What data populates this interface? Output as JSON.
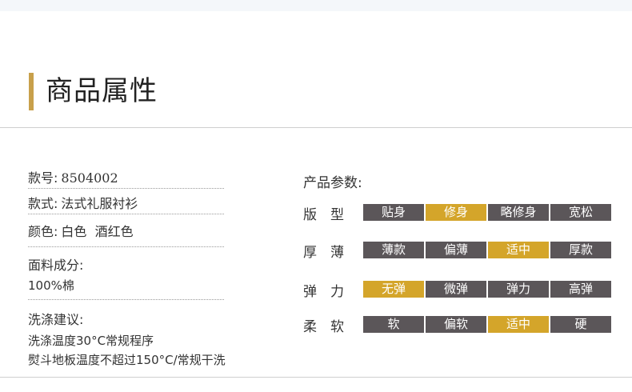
{
  "header": {
    "title": "商品属性"
  },
  "info": {
    "style_no": {
      "label": "款号:",
      "value": "8504002"
    },
    "style": {
      "label": "款式:",
      "value": "法式礼服衬衫"
    },
    "color": {
      "label": "颜色:",
      "value": "白色  酒红色"
    },
    "fabric": {
      "label": "面料成分:",
      "value": "100%棉"
    },
    "washing": {
      "label": "洗涤建议:",
      "line1": "洗涤温度30°C常规程序",
      "line2": "熨斗地板温度不超过150°C/常规干洗"
    }
  },
  "params": {
    "label": "产品参数:",
    "rows": [
      {
        "label_a": "版",
        "label_b": "型",
        "options": [
          "贴身",
          "修身",
          "略修身",
          "宽松"
        ],
        "selected": 1
      },
      {
        "label_a": "厚",
        "label_b": "薄",
        "options": [
          "薄款",
          "偏薄",
          "适中",
          "厚款"
        ],
        "selected": 2
      },
      {
        "label_a": "弹",
        "label_b": "力",
        "options": [
          "无弹",
          "微弹",
          "弹力",
          "高弹"
        ],
        "selected": 0
      },
      {
        "label_a": "柔",
        "label_b": "软",
        "options": [
          "软",
          "偏软",
          "适中",
          "硬"
        ],
        "selected": 2
      }
    ]
  },
  "colors": {
    "accent": "#c8a04b",
    "selected": "#d4a52a",
    "cell": "#5b5659"
  }
}
